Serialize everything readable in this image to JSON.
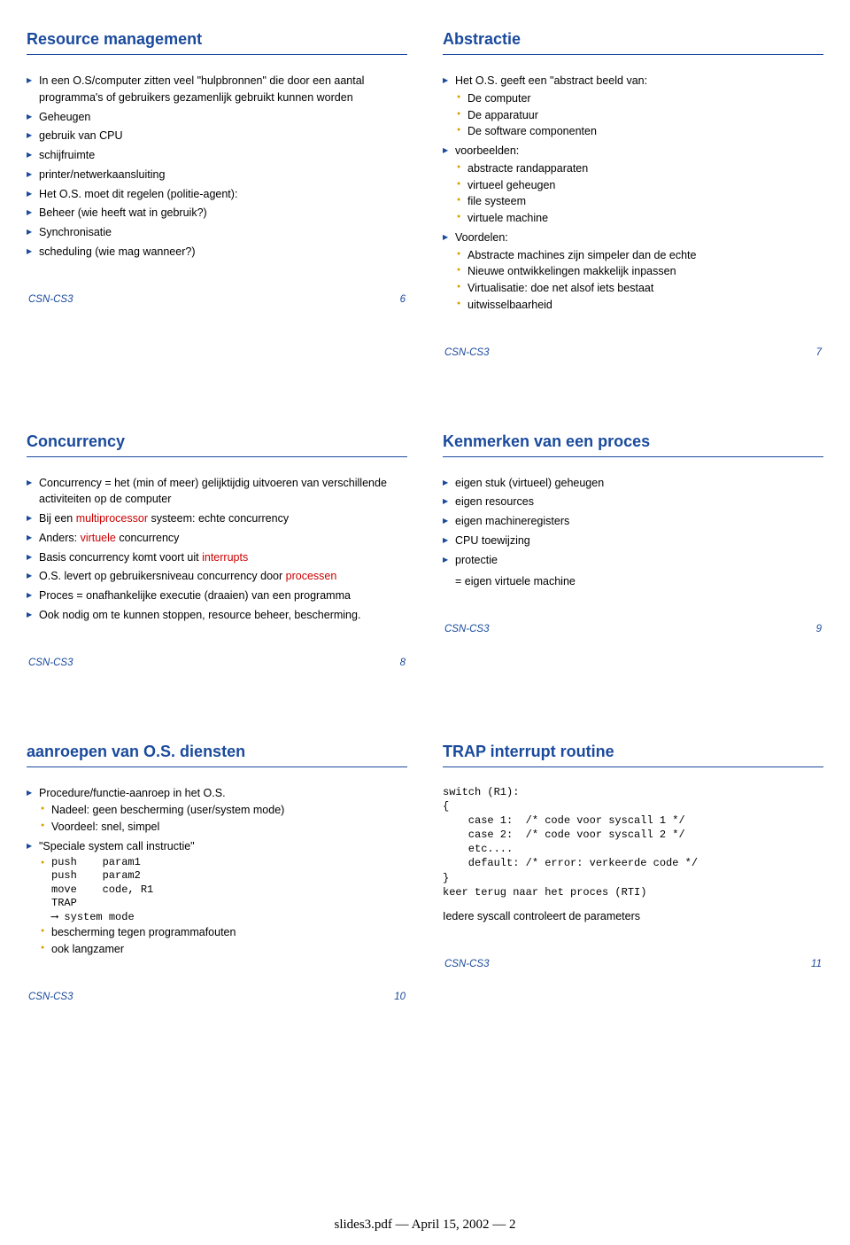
{
  "slides": {
    "s0": {
      "title": "Resource management",
      "items": [
        "In een O.S/computer zitten veel \"hulpbronnen\" die door een aantal programma's of gebruikers gezamenlijk gebruikt kunnen worden",
        "Geheugen",
        "gebruik van CPU",
        "schijfruimte",
        "printer/netwerkaansluiting",
        "Het O.S. moet dit regelen (politie-agent):",
        "Beheer (wie heeft wat in gebruik?)",
        "Synchronisatie",
        "scheduling (wie mag wanneer?)"
      ],
      "footer": {
        "left": "CSN-CS3",
        "right": "6"
      }
    },
    "s1": {
      "title": "Abstractie",
      "head1": "Het O.S. geeft een \"abstract beeld van:",
      "sub1": [
        "De computer",
        "De apparatuur",
        "De software componenten"
      ],
      "head2": "voorbeelden:",
      "sub2": [
        "abstracte randapparaten",
        "virtueel geheugen",
        "file systeem",
        "virtuele machine"
      ],
      "head3": "Voordelen:",
      "sub3": [
        "Abstracte machines zijn simpeler dan de echte",
        "Nieuwe ontwikkelingen makkelijk inpassen",
        "Virtualisatie: doe net alsof iets bestaat",
        "uitwisselbaarheid"
      ],
      "footer": {
        "left": "CSN-CS3",
        "right": "7"
      }
    },
    "s2": {
      "title": "Concurrency",
      "items": {
        "i0": "Concurrency = het (min of meer) gelijktijdig uitvoeren van verschillende activiteiten op de computer",
        "i1a": "Bij een ",
        "i1b": "multiprocessor",
        "i1c": " systeem: echte concurrency",
        "i2a": "Anders: ",
        "i2b": "virtuele",
        "i2c": " concurrency",
        "i3a": "Basis concurrency komt voort uit ",
        "i3b": "interrupts",
        "i4a": "O.S. levert op gebruikersniveau concurrency door ",
        "i4b": "processen",
        "i5": "Proces = onafhankelijke executie (draaien) van een programma",
        "i6": "Ook nodig om te kunnen stoppen, resource beheer, bescherming."
      },
      "footer": {
        "left": "CSN-CS3",
        "right": "8"
      }
    },
    "s3": {
      "title": "Kenmerken van een proces",
      "items": [
        "eigen stuk (virtueel) geheugen",
        "eigen resources",
        "eigen machineregisters",
        "CPU toewijzing",
        "protectie"
      ],
      "eq": "= eigen virtuele machine",
      "footer": {
        "left": "CSN-CS3",
        "right": "9"
      }
    },
    "s4": {
      "title": "aanroepen van O.S. diensten",
      "head1": "Procedure/functie-aanroep in het O.S.",
      "sub1": [
        "Nadeel: geen bescherming (user/system mode)",
        "Voordeel: snel, simpel"
      ],
      "head2": "\"Speciale system call instructie\"",
      "code": "push    param1\npush    param2\nmove    code, R1\nTRAP\n⟶ system mode",
      "sub2": [
        "bescherming tegen programmafouten",
        "ook langzamer"
      ],
      "footer": {
        "left": "CSN-CS3",
        "right": "10"
      }
    },
    "s5": {
      "title": "TRAP interrupt routine",
      "code": "switch (R1):\n{\n    case 1:  /* code voor syscall 1 */\n    case 2:  /* code voor syscall 2 */\n    etc....\n    default: /* error: verkeerde code */\n}\nkeer terug naar het proces (RTI)",
      "note": "Iedere syscall controleert de parameters",
      "footer": {
        "left": "CSN-CS3",
        "right": "11"
      }
    }
  },
  "doc_footer": "slides3.pdf — April 15, 2002 — 2"
}
